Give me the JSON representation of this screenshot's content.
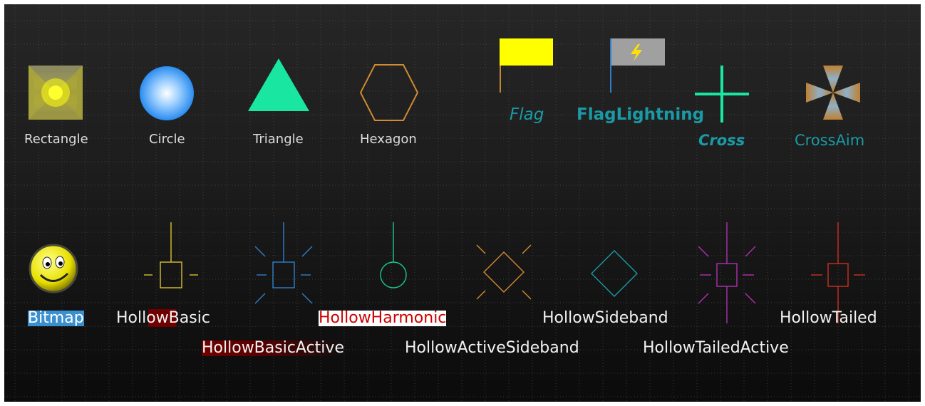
{
  "palette": {
    "background_top": "#262626",
    "background_bottom": "#0b0b0b",
    "grid_dot": "#5a5a5a",
    "label": "#dcdcdc",
    "teal_label": "#1a9aa5",
    "flag_yellow": "#ffff00",
    "bitmap_highlight": "#3a8fcf",
    "red_highlight": "#cc0000",
    "dark_red_highlight": "#700000"
  },
  "row1": {
    "rectangle": "Rectangle",
    "circle": "Circle",
    "triangle": "Triangle",
    "hexagon": "Hexagon",
    "flag": "Flag",
    "flag_lightning": "FlagLightning",
    "cross": "Cross",
    "cross_aim": "CrossAim"
  },
  "row2": {
    "bitmap": "Bitmap",
    "hollow_basic": "HollowBasic",
    "hollow_basic_active": "HollowBasicActive",
    "hollow_harmonic": "HollowHarmonic",
    "hollow_active_sideband": "HollowActiveSideband",
    "hollow_sideband": "HollowSideband",
    "hollow_tailed_active": "HollowTailedActive",
    "hollow_tailed": "HollowTailed"
  },
  "icons": {
    "rectangle": "rectangle-marker-icon",
    "circle": "circle-marker-icon",
    "triangle": "triangle-marker-icon",
    "hexagon": "hexagon-marker-icon",
    "flag": "flag-marker-icon",
    "flag_lightning": "flag-lightning-marker-icon",
    "cross": "cross-marker-icon",
    "cross_aim": "cross-aim-marker-icon",
    "bitmap": "smiley-bitmap-icon",
    "hollow_basic": "hollow-basic-marker-icon",
    "hollow_basic_active": "hollow-basic-active-marker-icon",
    "hollow_harmonic": "hollow-harmonic-marker-icon",
    "hollow_active_sideband": "hollow-active-sideband-marker-icon",
    "hollow_sideband": "hollow-sideband-marker-icon",
    "hollow_tailed_active": "hollow-tailed-active-marker-icon",
    "hollow_tailed": "hollow-tailed-marker-icon"
  },
  "marker_colors": {
    "rectangle_center": "#ffff10",
    "rectangle_edge": "#8c8a5e",
    "circle_center": "#ffffff",
    "circle_edge": "#2a8cf0",
    "triangle": "#19e6a0",
    "hexagon": "#d08a30",
    "flag_pole": "#c08830",
    "flag_lightning_body": "#a0a0a0",
    "flag_lightning_pole": "#2e7fc8",
    "lightning_bolt": "#ffe000",
    "cross": "#19e6a0",
    "cross_aim_outer": "#c08030",
    "cross_aim_inner": "#8fb0c8",
    "hollow_basic": "#d8c030",
    "hollow_basic_active": "#2e7fc8",
    "hollow_harmonic": "#19c890",
    "hollow_active_sideband": "#d08a30",
    "hollow_sideband": "#1a9aa5",
    "hollow_tailed_active": "#b030b0",
    "hollow_tailed": "#cc3020"
  }
}
